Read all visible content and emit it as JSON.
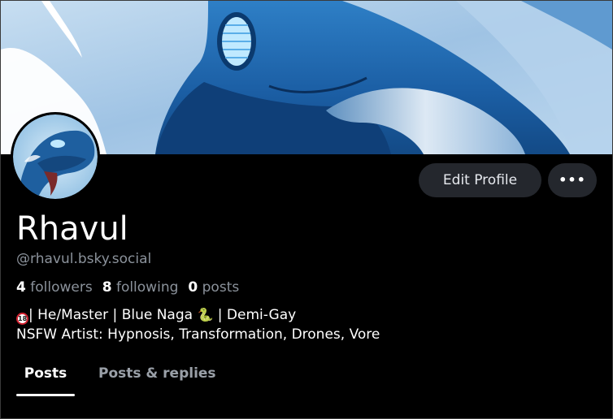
{
  "profile": {
    "display_name": "Rhavul",
    "handle": "@rhavul.bsky.social",
    "stats": {
      "followers_count": "4",
      "followers_label": "followers",
      "following_count": "8",
      "following_label": "following",
      "posts_count": "0",
      "posts_label": "posts"
    },
    "bio": {
      "line1_text": "| He/Master | Blue Naga ",
      "line1_suffix": " | Demi-Gay",
      "line2": "NSFW Artist: Hypnosis, Transformation, Drones, Vore",
      "badge_text": "18",
      "snake_glyph": "🐍"
    }
  },
  "actions": {
    "edit_profile_label": "Edit Profile",
    "more_label": "•••"
  },
  "tabs": [
    {
      "label": "Posts",
      "active": true
    },
    {
      "label": "Posts & replies",
      "active": false
    }
  ],
  "icons": {
    "banner": "blue-naga-banner-art",
    "avatar": "blue-naga-avatar",
    "more": "ellipsis-icon",
    "adult": "18-plus-badge-icon",
    "snake": "snake-emoji-icon"
  },
  "colors": {
    "background": "#000000",
    "button_bg": "#24272d",
    "muted_text": "#8b929b",
    "tab_inactive": "#9aa0a8",
    "naga_blue": "#1f5f9e",
    "sky_blue": "#a9cbe9"
  }
}
